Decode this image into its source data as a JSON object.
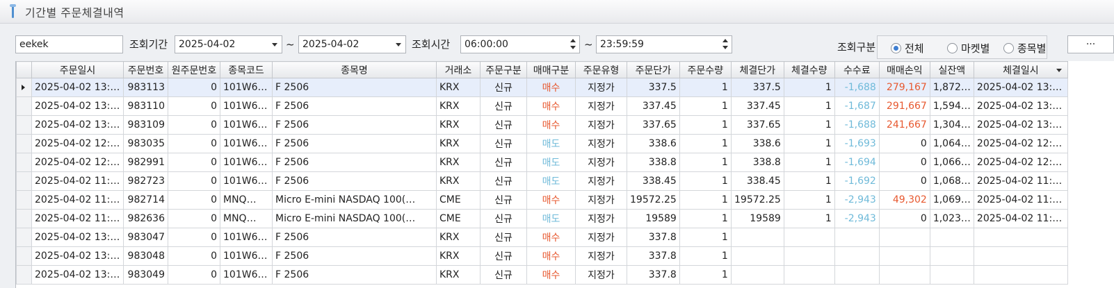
{
  "window": {
    "title": "기간별 주문체결내역"
  },
  "filters": {
    "account": "eekek",
    "period_label": "조회기간",
    "date_from": "2025-04-02",
    "tilde": "~",
    "date_to": "2025-04-02",
    "time_label": "조회시간",
    "time_from": "06:00:00",
    "time_to": "23:59:59",
    "query_type_label": "조회구분",
    "radios": [
      {
        "label": "전체",
        "checked": true
      },
      {
        "label": "마켓별",
        "checked": false
      },
      {
        "label": "종목별",
        "checked": false
      }
    ],
    "more": "···"
  },
  "colors": {
    "buy": "#e7582f",
    "sell": "#6fbad9",
    "selected_row": "#e7eefb",
    "radio_on": "#3e7ed1"
  },
  "table": {
    "columns": [
      "주문일시",
      "주문번호",
      "원주문번호",
      "종목코드",
      "종목명",
      "거래소",
      "주문구분",
      "매매구분",
      "주문유형",
      "주문단가",
      "주문수량",
      "체결단가",
      "체결수량",
      "수수료",
      "매매손익",
      "실잔액",
      "체결일시"
    ],
    "rows": [
      [
        "2025-04-02 13:…",
        "983113",
        "0",
        "101W6…",
        "F 2506",
        "KRX",
        "신규",
        "매수",
        "지정가",
        "337.5",
        "1",
        "337.5",
        "1",
        "-1,688",
        "279,167",
        "1,872…",
        "2025-04-02 13:…"
      ],
      [
        "2025-04-02 13:…",
        "983110",
        "0",
        "101W6…",
        "F 2506",
        "KRX",
        "신규",
        "매수",
        "지정가",
        "337.45",
        "1",
        "337.45",
        "1",
        "-1,687",
        "291,667",
        "1,594…",
        "2025-04-02 13:…"
      ],
      [
        "2025-04-02 13:…",
        "983109",
        "0",
        "101W6…",
        "F 2506",
        "KRX",
        "신규",
        "매수",
        "지정가",
        "337.65",
        "1",
        "337.65",
        "1",
        "-1,688",
        "241,667",
        "1,304…",
        "2025-04-02 13:…"
      ],
      [
        "2025-04-02 12:…",
        "983035",
        "0",
        "101W6…",
        "F 2506",
        "KRX",
        "신규",
        "매도",
        "지정가",
        "338.6",
        "1",
        "338.6",
        "1",
        "-1,693",
        "0",
        "1,064…",
        "2025-04-02 12:…"
      ],
      [
        "2025-04-02 12:…",
        "982991",
        "0",
        "101W6…",
        "F 2506",
        "KRX",
        "신규",
        "매도",
        "지정가",
        "338.8",
        "1",
        "338.8",
        "1",
        "-1,694",
        "0",
        "1,066…",
        "2025-04-02 12:…"
      ],
      [
        "2025-04-02 11:…",
        "982723",
        "0",
        "101W6…",
        "F 2506",
        "KRX",
        "신규",
        "매도",
        "지정가",
        "338.45",
        "1",
        "338.45",
        "1",
        "-1,692",
        "0",
        "1,068…",
        "2025-04-02 11:…"
      ],
      [
        "2025-04-02 11:…",
        "982714",
        "0",
        "MNQ…",
        "Micro E-mini NASDAQ 100(…",
        "CME",
        "신규",
        "매수",
        "지정가",
        "19572.25",
        "1",
        "19572.25",
        "1",
        "-2,943",
        "49,302",
        "1,069…",
        "2025-04-02 11:…"
      ],
      [
        "2025-04-02 11:…",
        "982636",
        "0",
        "MNQ…",
        "Micro E-mini NASDAQ 100(…",
        "CME",
        "신규",
        "매도",
        "지정가",
        "19589",
        "1",
        "19589",
        "1",
        "-2,943",
        "0",
        "1,023…",
        "2025-04-02 11:…"
      ],
      [
        "2025-04-02 13:…",
        "983047",
        "0",
        "101W6…",
        "F 2506",
        "KRX",
        "신규",
        "매수",
        "지정가",
        "337.8",
        "1",
        "",
        "",
        "",
        "",
        "",
        ""
      ],
      [
        "2025-04-02 13:…",
        "983048",
        "0",
        "101W6…",
        "F 2506",
        "KRX",
        "신규",
        "매수",
        "지정가",
        "337.8",
        "1",
        "",
        "",
        "",
        "",
        "",
        ""
      ],
      [
        "2025-04-02 13:…",
        "983049",
        "0",
        "101W6…",
        "F 2506",
        "KRX",
        "신규",
        "매수",
        "지정가",
        "337.8",
        "1",
        "",
        "",
        "",
        "",
        "",
        ""
      ]
    ]
  }
}
